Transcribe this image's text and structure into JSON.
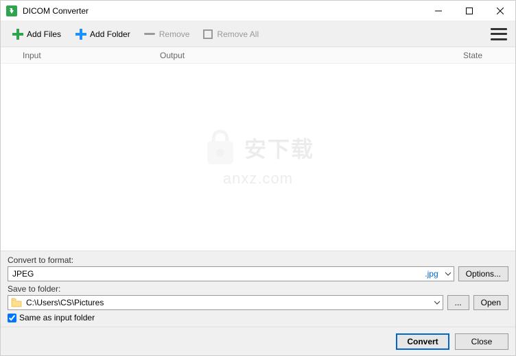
{
  "window": {
    "title": "DICOM Converter"
  },
  "toolbar": {
    "add_files": "Add Files",
    "add_folder": "Add Folder",
    "remove": "Remove",
    "remove_all": "Remove All"
  },
  "list": {
    "columns": {
      "input": "Input",
      "output": "Output",
      "state": "State"
    }
  },
  "watermark": {
    "cn": "安下载",
    "en": "anxz.com"
  },
  "convert": {
    "label": "Convert to format:",
    "format_name": "JPEG",
    "format_ext": ".jpg",
    "options_btn": "Options..."
  },
  "save": {
    "label": "Save to folder:",
    "path": "C:\\Users\\CS\\Pictures",
    "browse_btn": "...",
    "open_btn": "Open",
    "same_as_input": "Same as input folder"
  },
  "footer": {
    "convert": "Convert",
    "close": "Close"
  }
}
